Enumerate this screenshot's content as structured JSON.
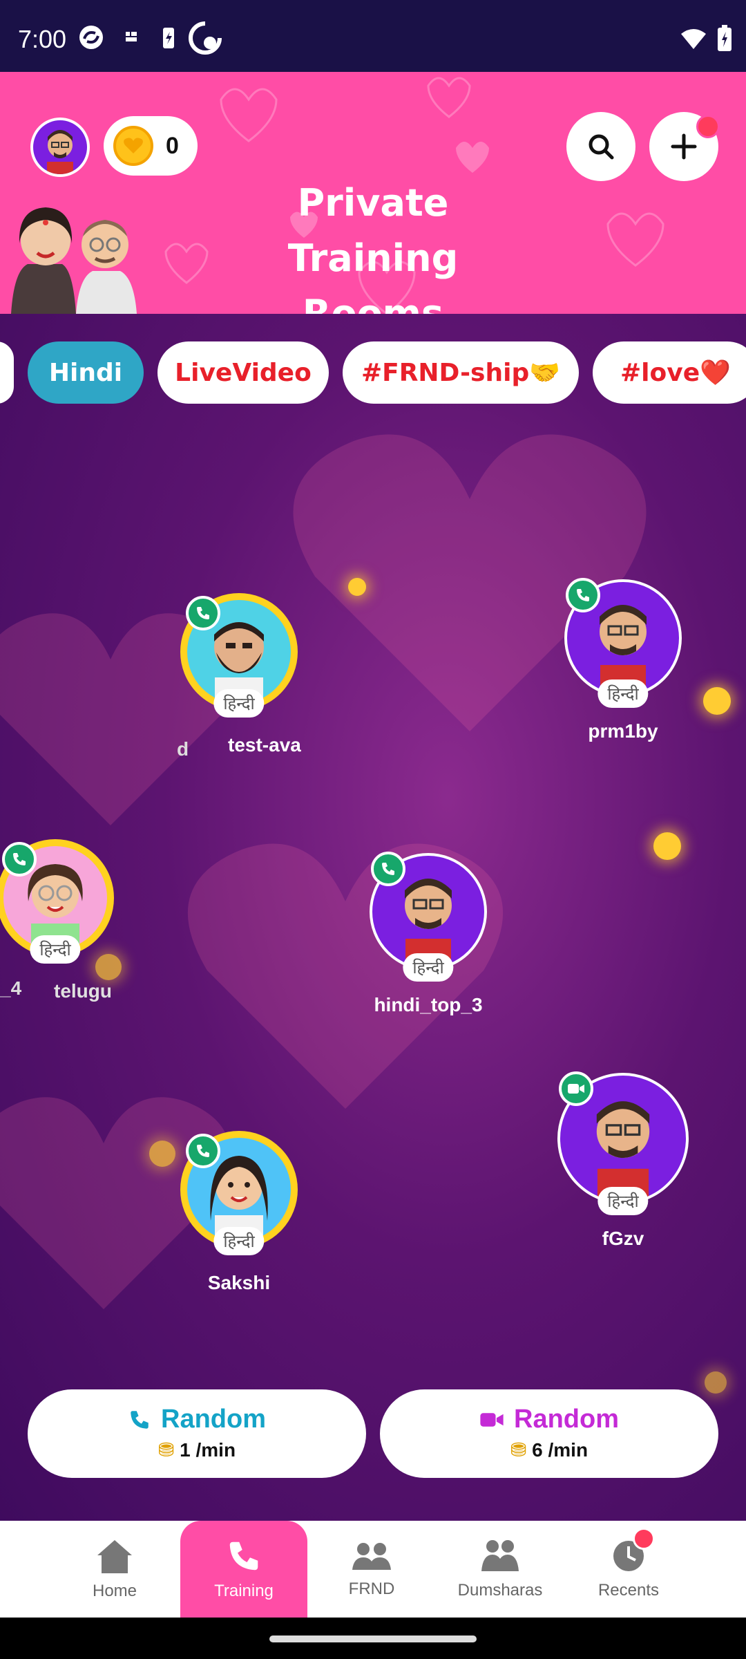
{
  "status_bar": {
    "time": "7:00"
  },
  "header": {
    "coins": "0",
    "title_line1": "Private Training",
    "title_line2": "Rooms"
  },
  "chips": [
    {
      "label": "Hindi",
      "color": "#ffffff"
    },
    {
      "label": "LiveVideo",
      "color": "#e8202a"
    },
    {
      "label": "#FRND-ship🤝",
      "color": "#e8202a"
    },
    {
      "label": "#love❤️",
      "color": "#e8202a"
    }
  ],
  "users": [
    {
      "name": "test-ava",
      "lang": "हिन्दी",
      "call": "voice"
    },
    {
      "name": "prm1by",
      "lang": "हिन्दी",
      "call": "voice"
    },
    {
      "name": "telugu",
      "lang": "हिन्दी",
      "call": "voice"
    },
    {
      "name": "hindi_top_3",
      "lang": "हिन्दी",
      "call": "voice"
    },
    {
      "name": "fGzv",
      "lang": "हिन्दी",
      "call": "video"
    },
    {
      "name": "Sakshi",
      "lang": "हिन्दी",
      "call": "voice"
    }
  ],
  "edge_labels": {
    "left1": "d",
    "left2": "_4"
  },
  "random": {
    "voice": {
      "title": "Random",
      "rate": "1 /min",
      "color": "#14a3c7"
    },
    "video": {
      "title": "Random",
      "rate": "6 /min",
      "color": "#c42ad6"
    }
  },
  "nav": [
    {
      "label": "Home"
    },
    {
      "label": "Training"
    },
    {
      "label": "FRND"
    },
    {
      "label": "Dumsharas"
    },
    {
      "label": "Recents"
    }
  ],
  "colors": {
    "accent": "#ff4da6",
    "status_bg": "#1a1147",
    "active_chip": "#2fa6c6"
  }
}
